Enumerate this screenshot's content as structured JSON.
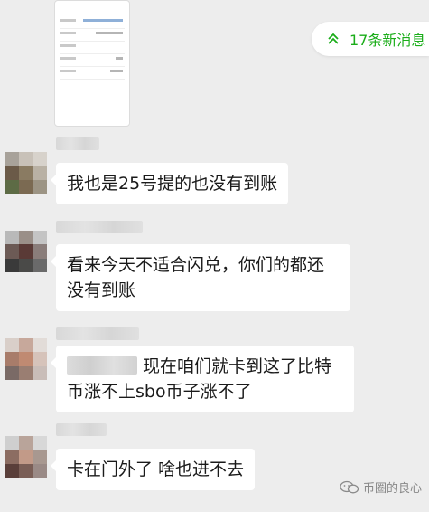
{
  "new_messages": {
    "label": "17条新消息"
  },
  "messages": [
    {
      "text": "我也是25号提的也没有到账"
    },
    {
      "text": "看来今天不适合闪兑，你们的都还没有到账"
    },
    {
      "text": "现在咱们就卡到这了比特币涨不上sbo币子涨不了"
    },
    {
      "text": "卡在门外了 啥也进不去"
    }
  ],
  "watermark": {
    "text": "币圈的良心"
  },
  "icons": {
    "new_messages": "double-chevron-up-icon",
    "watermark": "wechat-official-account-icon"
  },
  "colors": {
    "background": "#ededed",
    "bubble": "#ffffff",
    "accent_green": "#1aad19",
    "text": "#1a1a1a"
  }
}
